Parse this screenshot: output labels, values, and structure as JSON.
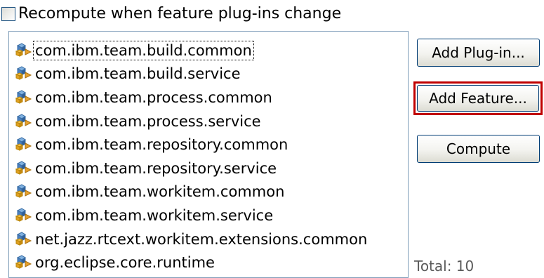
{
  "checkbox": {
    "label": "Recompute when feature plug-ins change",
    "checked": false
  },
  "plugins": {
    "icon": "plugin-icon",
    "items": [
      {
        "label": "com.ibm.team.build.common",
        "focused": true
      },
      {
        "label": "com.ibm.team.build.service",
        "focused": false
      },
      {
        "label": "com.ibm.team.process.common",
        "focused": false
      },
      {
        "label": "com.ibm.team.process.service",
        "focused": false
      },
      {
        "label": "com.ibm.team.repository.common",
        "focused": false
      },
      {
        "label": "com.ibm.team.repository.service",
        "focused": false
      },
      {
        "label": "com.ibm.team.workitem.common",
        "focused": false
      },
      {
        "label": "com.ibm.team.workitem.service",
        "focused": false
      },
      {
        "label": "net.jazz.rtcext.workitem.extensions.common",
        "focused": false
      },
      {
        "label": "org.eclipse.core.runtime",
        "focused": false
      }
    ]
  },
  "buttons": {
    "add_plugin": "Add Plug-in...",
    "add_feature": "Add Feature...",
    "compute": "Compute"
  },
  "total": {
    "text": "Total: 10"
  },
  "colors": {
    "highlight_border": "#c00000",
    "button_border": "#003c74",
    "list_border": "#7f9db9"
  }
}
